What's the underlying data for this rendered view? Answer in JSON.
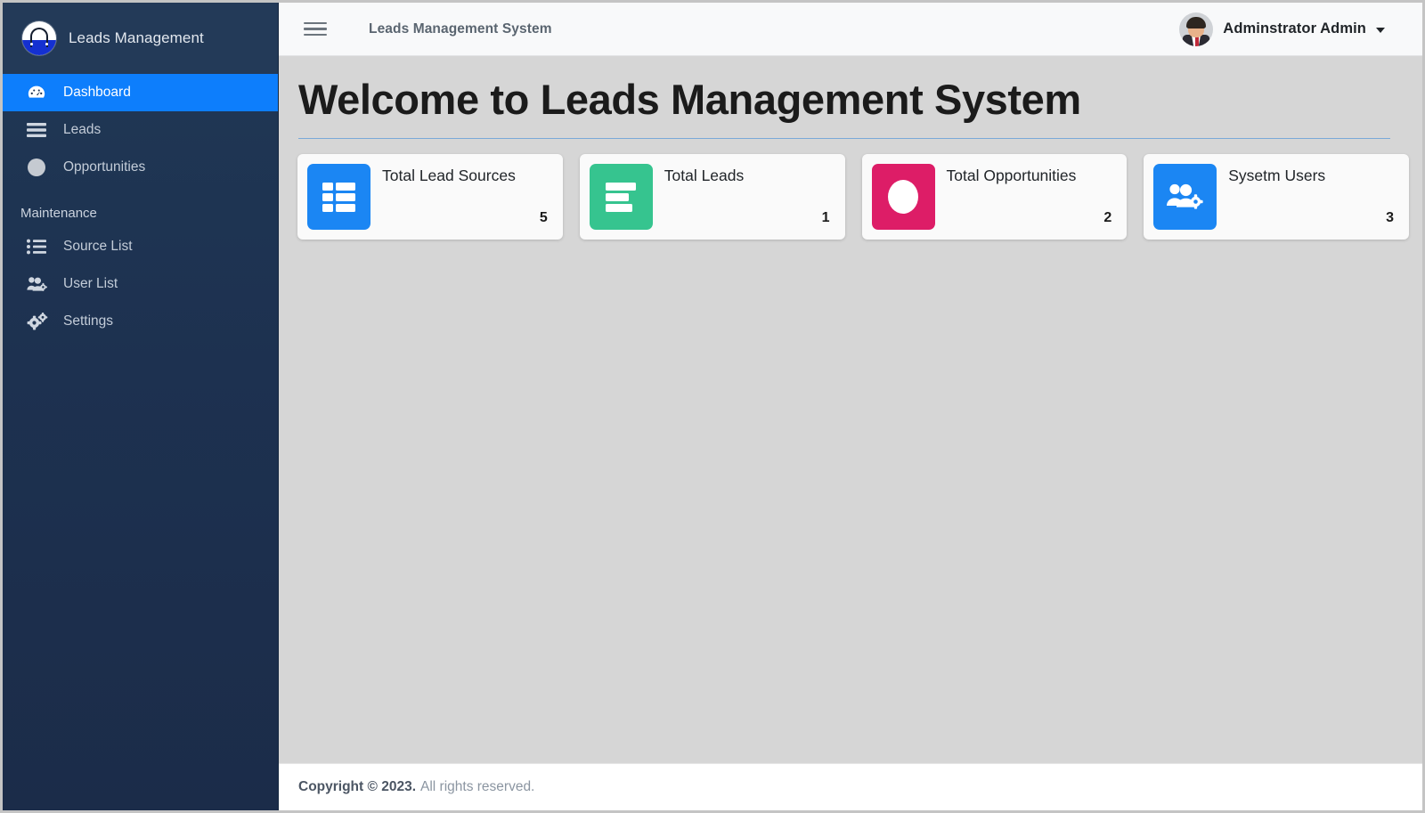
{
  "sidebar": {
    "brand": {
      "title": "Leads Management",
      "logo_icon": "shopping-bag-lock-icon"
    },
    "items": [
      {
        "label": "Dashboard",
        "icon": "tachometer-dashboard-icon",
        "active": true
      },
      {
        "label": "Leads",
        "icon": "align-justify-bars-icon",
        "active": false
      },
      {
        "label": "Opportunities",
        "icon": "filled-circle-icon",
        "active": false
      }
    ],
    "section_label": "Maintenance",
    "maintenance_items": [
      {
        "label": "Source List",
        "icon": "list-ul-icon"
      },
      {
        "label": "User List",
        "icon": "users-cog-icon"
      },
      {
        "label": "Settings",
        "icon": "cogs-icon"
      }
    ],
    "colors": {
      "background": "#1e3350",
      "active": "#0d7efc",
      "text": "#c3ccd8"
    }
  },
  "topbar": {
    "menu_toggle_icon": "hamburger-icon",
    "title": "Leads Management System",
    "user": {
      "name": "Adminstrator Admin",
      "avatar_icon": "user-avatar-icon",
      "caret_icon": "chevron-down-icon"
    }
  },
  "page": {
    "title": "Welcome to Leads Management System",
    "rule_color": "#7aa9d8"
  },
  "cards": [
    {
      "label": "Total Lead Sources",
      "value": "5",
      "icon": "table-grid-icon",
      "color": "#1b86f3"
    },
    {
      "label": "Total Leads",
      "value": "1",
      "icon": "align-left-bars-icon",
      "color": "#36c48f"
    },
    {
      "label": "Total Opportunities",
      "value": "2",
      "icon": "circle-icon",
      "color": "#dd1d67"
    },
    {
      "label": "Sysetm Users",
      "value": "3",
      "icon": "users-cog-icon",
      "color": "#1b86f3"
    }
  ],
  "footer": {
    "copyright": "Copyright © 2023.",
    "rights": "All rights reserved."
  }
}
